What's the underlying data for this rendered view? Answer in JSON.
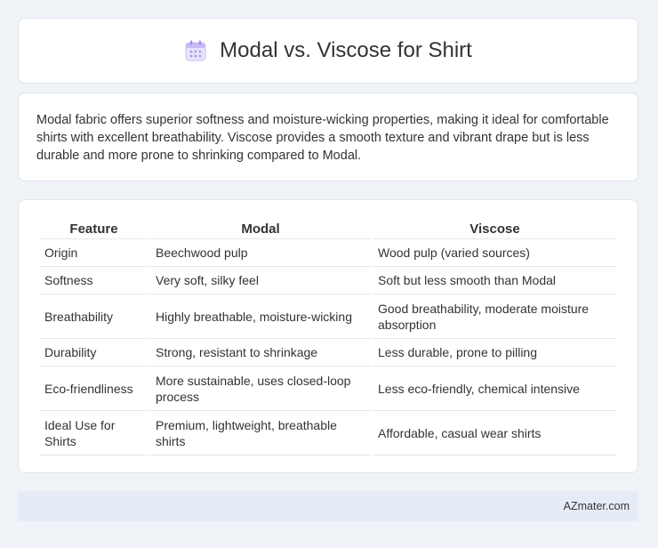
{
  "header": {
    "icon": "calendar-icon",
    "title": "Modal vs. Viscose for Shirt"
  },
  "description": "Modal fabric offers superior softness and moisture-wicking properties, making it ideal for comfortable shirts with excellent breathability. Viscose provides a smooth texture and vibrant drape but is less durable and more prone to shrinking compared to Modal.",
  "table": {
    "headers": [
      "Feature",
      "Modal",
      "Viscose"
    ],
    "rows": [
      [
        "Origin",
        "Beechwood pulp",
        "Wood pulp (varied sources)"
      ],
      [
        "Softness",
        "Very soft, silky feel",
        "Soft but less smooth than Modal"
      ],
      [
        "Breathability",
        "Highly breathable, moisture-wicking",
        "Good breathability, moderate moisture absorption"
      ],
      [
        "Durability",
        "Strong, resistant to shrinkage",
        "Less durable, prone to pilling"
      ],
      [
        "Eco-friendliness",
        "More sustainable, uses closed-loop process",
        "Less eco-friendly, chemical intensive"
      ],
      [
        "Ideal Use for Shirts",
        "Premium, lightweight, breathable shirts",
        "Affordable, casual wear shirts"
      ]
    ]
  },
  "footer": {
    "brand": "AZmater.com"
  }
}
